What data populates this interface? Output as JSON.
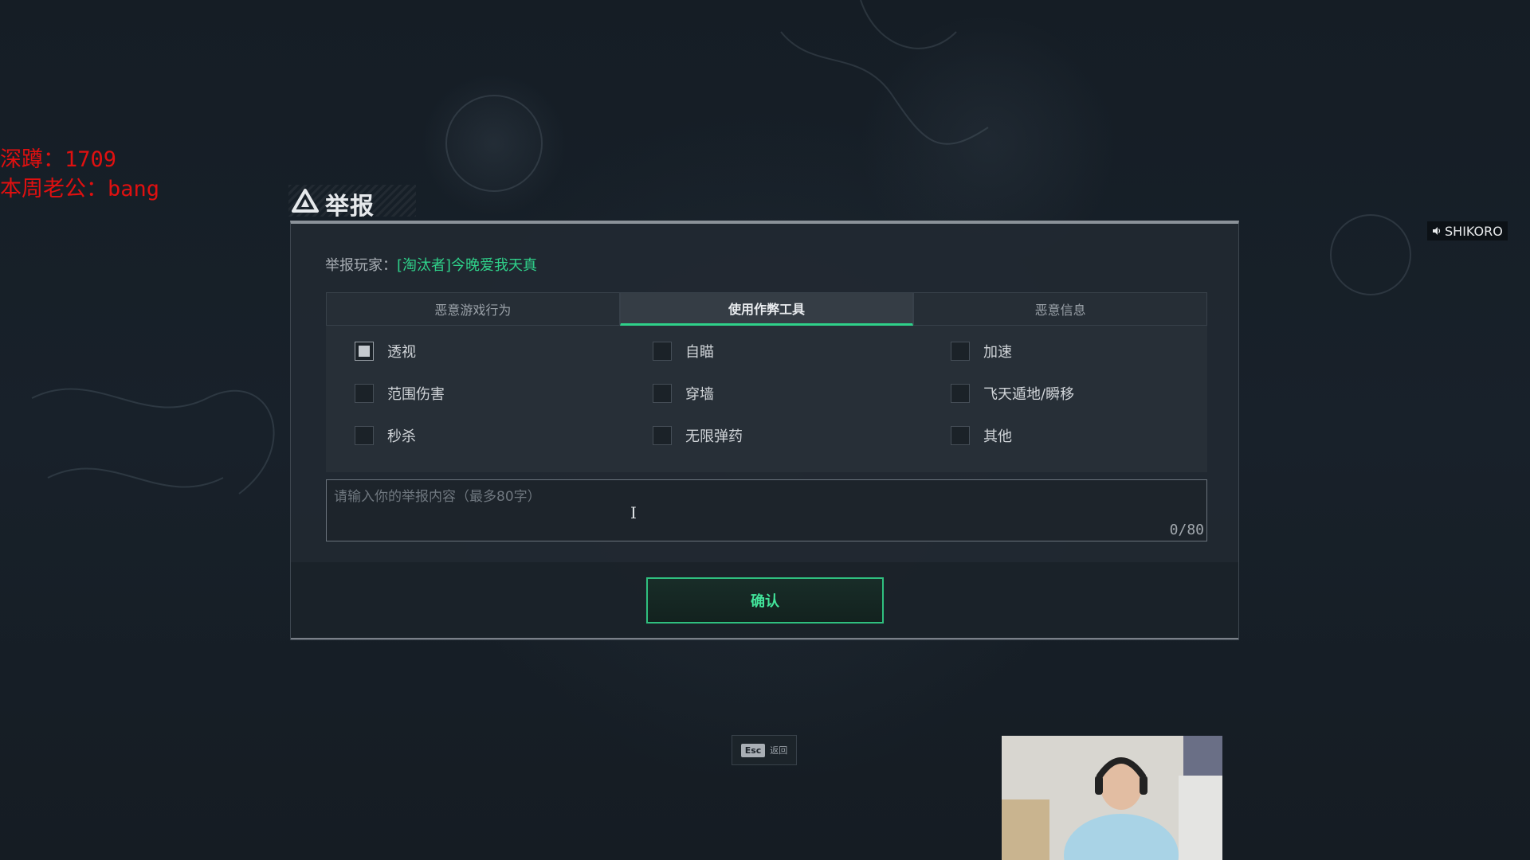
{
  "overlay": {
    "line1": "深蹲：1709",
    "line2": "本周老公：bang"
  },
  "dialog": {
    "title": "举报",
    "reported_label": "举报玩家：",
    "reported_name": "[淘汰者]今晚爱我天真",
    "tabs": [
      {
        "label": "恶意游戏行为",
        "active": false
      },
      {
        "label": "使用作弊工具",
        "active": true
      },
      {
        "label": "恶意信息",
        "active": false
      }
    ],
    "options": [
      {
        "label": "透视",
        "checked": true
      },
      {
        "label": "自瞄",
        "checked": false
      },
      {
        "label": "加速",
        "checked": false
      },
      {
        "label": "范围伤害",
        "checked": false
      },
      {
        "label": "穿墙",
        "checked": false
      },
      {
        "label": "飞天遁地/瞬移",
        "checked": false
      },
      {
        "label": "秒杀",
        "checked": false
      },
      {
        "label": "无限弹药",
        "checked": false
      },
      {
        "label": "其他",
        "checked": false
      }
    ],
    "report_input": {
      "placeholder": "请输入你的举报内容（最多80字）",
      "counter": "0/80"
    },
    "confirm_label": "确认"
  },
  "esc_hint": {
    "key": "Esc",
    "label": "返回"
  },
  "voice_tag": {
    "icon": "speaker-icon",
    "name": "SHIKORO"
  },
  "colors": {
    "accent": "#2fd18a",
    "overlay_text": "#e01010"
  }
}
